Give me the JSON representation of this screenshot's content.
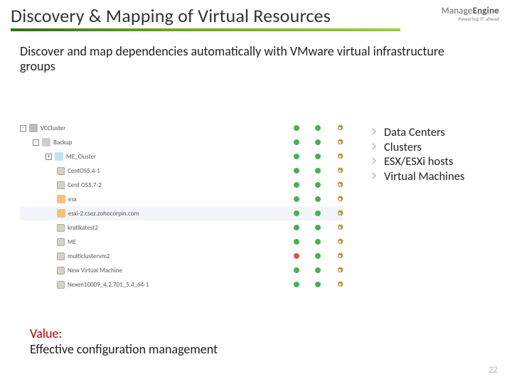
{
  "header": {
    "title": "Discovery & Mapping of Virtual Resources",
    "logo_main_light": "Manage",
    "logo_main_bold": "Engine",
    "logo_sub": "Powering IT ahead"
  },
  "intro": "Discover and map dependencies automatically with VMware virtual infrastructure groups",
  "tree": {
    "rows": [
      {
        "indent": 1,
        "toggle": "-",
        "icon": "vc",
        "label": "VCCluster"
      },
      {
        "indent": 2,
        "toggle": "-",
        "icon": "dc",
        "label": "Backup"
      },
      {
        "indent": 3,
        "toggle": "+",
        "icon": "cl",
        "label": "ME_Cluster"
      },
      {
        "indent": 4,
        "toggle": "",
        "icon": "vm",
        "label": "CentOS5.4-1"
      },
      {
        "indent": 4,
        "toggle": "",
        "icon": "vm",
        "label": "Cent OS5.7-2"
      },
      {
        "indent": 4,
        "toggle": "",
        "icon": "host",
        "label": "esx"
      },
      {
        "indent": 4,
        "toggle": "",
        "icon": "host",
        "label": "esxi-2.csez.zohocorpin.com"
      },
      {
        "indent": 4,
        "toggle": "",
        "icon": "vm",
        "label": "kratikatest2"
      },
      {
        "indent": 4,
        "toggle": "",
        "icon": "vm",
        "label": "ME"
      },
      {
        "indent": 4,
        "toggle": "",
        "icon": "vm",
        "label": "multiclustervm2",
        "red_idx": 0
      },
      {
        "indent": 4,
        "toggle": "",
        "icon": "vm",
        "label": "New Virtual Machine"
      },
      {
        "indent": 4,
        "toggle": "",
        "icon": "vm",
        "label": "Nexen10009_4.2.701_5.4_64-1"
      }
    ]
  },
  "bullets": [
    "Data Centers",
    "Clusters",
    "ESX/ESXi hosts",
    "Virtual Machines"
  ],
  "value": {
    "label": "Value:",
    "text": "Effective configuration management"
  },
  "page_number": "22"
}
